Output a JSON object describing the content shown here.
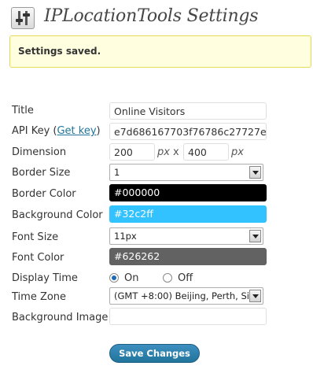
{
  "header": {
    "title": "IPLocationTools Settings",
    "icon": "settings-sliders-icon"
  },
  "notice": {
    "text": "Settings saved."
  },
  "form": {
    "title": {
      "label": "Title",
      "value": "Online Visitors"
    },
    "api_key": {
      "label_prefix": "API Key (",
      "link_text": "Get key",
      "label_suffix": ")",
      "value": "e7d686167703f76786c27727e"
    },
    "dimension": {
      "label": "Dimension",
      "width": "200",
      "height": "400",
      "unit1": "px",
      "separator": "x",
      "unit2": "px"
    },
    "border_size": {
      "label": "Border Size",
      "value": "1"
    },
    "border_color": {
      "label": "Border Color",
      "value": "#000000",
      "swatch": "#000000",
      "text_color": "#ffffff"
    },
    "background_color": {
      "label": "Background Color",
      "value": "#32c2ff",
      "swatch": "#32c2ff",
      "text_color": "#ffffff"
    },
    "font_size": {
      "label": "Font Size",
      "value": "11px"
    },
    "font_color": {
      "label": "Font Color",
      "value": "#626262",
      "swatch": "#626262",
      "text_color": "#ffffff"
    },
    "display_time": {
      "label": "Display Time",
      "on_label": "On",
      "off_label": "Off",
      "selected": "On"
    },
    "time_zone": {
      "label": "Time Zone",
      "value": "(GMT +8:00) Beijing, Perth, Si"
    },
    "background_image": {
      "label": "Background Image",
      "value": ""
    }
  },
  "save_button": {
    "label": "Save Changes"
  },
  "colors": {
    "accent": "#21759b",
    "notice_bg": "#ffffe0",
    "notice_border": "#e6db55"
  }
}
